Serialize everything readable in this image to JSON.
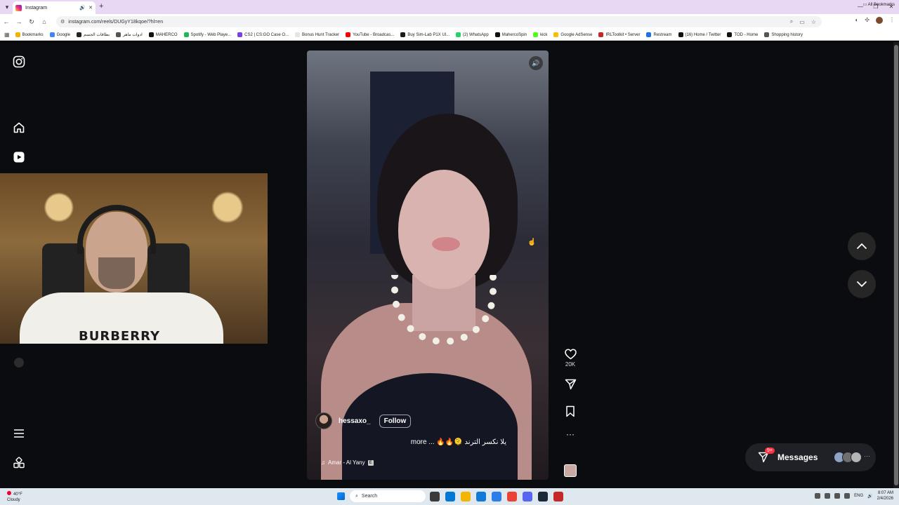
{
  "browser": {
    "tab_title": "Instagram",
    "url": "instagram.com/reels/DUGyY18kqoe/?hl=en",
    "bookmarks": [
      "Bookmarks",
      "Google",
      "بطاقات الجسم",
      "ادوات ماهر",
      "MAHERCO",
      "Spotify - Web Playe...",
      "CS2 | CS:GO Case O...",
      "Bonus Hunt Tracker",
      "YouTube - Broadcas...",
      "Buy Sim-Lab P1X Ul...",
      "(2) WhatsApp",
      "MahercoSpin",
      "kick",
      "Google AdSense",
      "IRLToolkit • Server",
      "Restream",
      "(16) Home / Twitter",
      "TOD - Home",
      "Shopping history"
    ],
    "bookmark_colors": [
      "#f0b400",
      "#4285f4",
      "#222",
      "#555",
      "#111",
      "#1db954",
      "#7b3fe4",
      "#e5e5e5",
      "#ff0000",
      "#1a1a1a",
      "#25d366",
      "#111",
      "#53fc18",
      "#fbbc04",
      "#c62828",
      "#1a73e8",
      "#111",
      "#111",
      "#555"
    ],
    "all_bookmarks": "All Bookmarks"
  },
  "reel": {
    "username": "hessaxo_",
    "follow": "Follow",
    "caption": "يلا نكسر الترند 🫠🔥🔥 ... more",
    "audio": "Amar - Al Yany",
    "likes": "20K"
  },
  "webcam": {
    "shirt_text": "BURBERRY"
  },
  "messages": {
    "label": "Messages",
    "badge": "9+"
  },
  "taskbar": {
    "weather_temp": "40°F",
    "weather_desc": "Cloudy",
    "search": "Search",
    "lang": "ENG",
    "time": "8:07 AM",
    "date": "2/4/2026"
  }
}
